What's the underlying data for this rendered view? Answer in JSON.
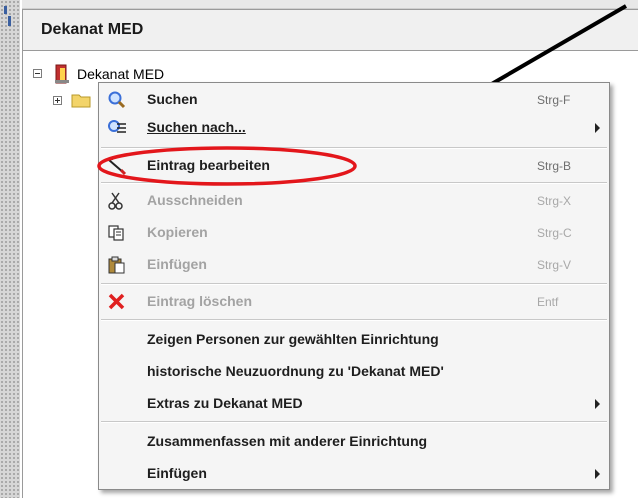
{
  "panel": {
    "title": "Dekanat MED",
    "root_node_label": "Dekanat MED"
  },
  "colors": {
    "annotation_red": "#e3161b",
    "annotation_line": "#000000",
    "delete_icon": "#e02020",
    "search_icon": "#3a6fd8"
  },
  "context_menu": {
    "items": [
      {
        "label": "Suchen",
        "shortcut": "Strg-F",
        "icon": "search-icon",
        "enabled": true
      },
      {
        "label": "Suchen nach...",
        "shortcut": "",
        "icon": "search-list-icon",
        "enabled": true,
        "submenu": true
      },
      {
        "label": "Eintrag bearbeiten",
        "shortcut": "Strg-B",
        "icon": "edit-icon",
        "enabled": true
      },
      {
        "label": "Ausschneiden",
        "shortcut": "Strg-X",
        "icon": "scissors-icon",
        "enabled": false
      },
      {
        "label": "Kopieren",
        "shortcut": "Strg-C",
        "icon": "copy-icon",
        "enabled": false
      },
      {
        "label": "Einfügen",
        "shortcut": "Strg-V",
        "icon": "paste-icon",
        "enabled": false
      },
      {
        "label": "Eintrag löschen",
        "shortcut": "Entf",
        "icon": "delete-icon",
        "enabled": false
      },
      {
        "label": "Zeigen Personen zur gewählten Einrichtung",
        "shortcut": "",
        "enabled": true
      },
      {
        "label": "historische Neuzuordnung zu 'Dekanat MED'",
        "shortcut": "",
        "enabled": true
      },
      {
        "label": "Extras zu Dekanat MED",
        "shortcut": "",
        "enabled": true,
        "submenu": true
      },
      {
        "label": "Zusammenfassen mit anderer Einrichtung",
        "shortcut": "",
        "enabled": true
      },
      {
        "label": "Einfügen",
        "shortcut": "",
        "enabled": true,
        "submenu": true
      }
    ]
  }
}
